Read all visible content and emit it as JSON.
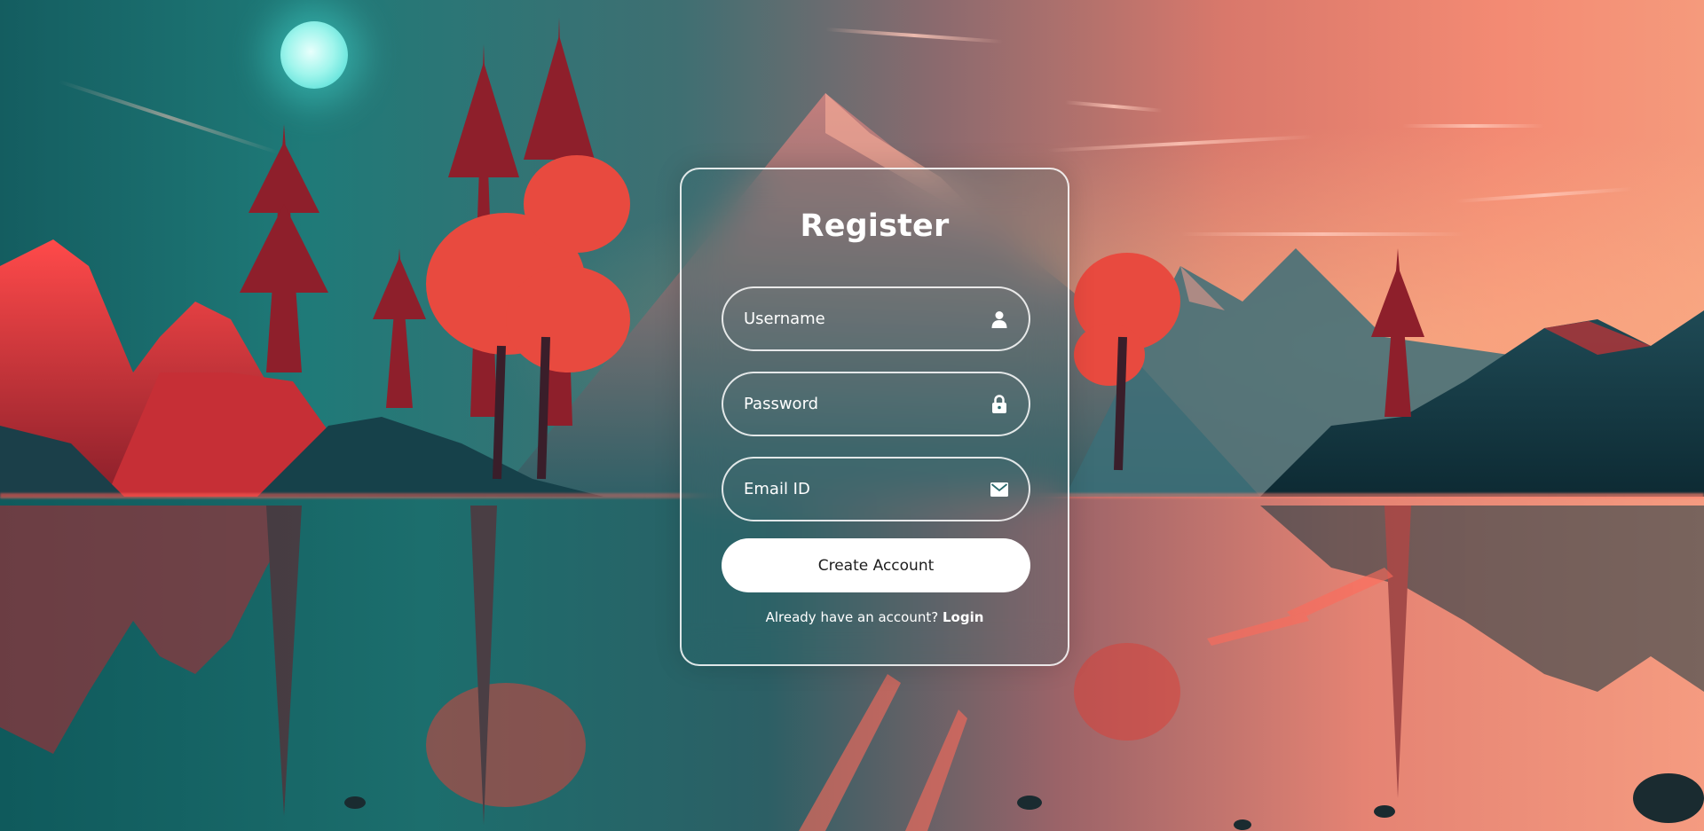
{
  "form": {
    "title": "Register",
    "username": {
      "placeholder": "Username",
      "value": "",
      "icon": "user-icon"
    },
    "password": {
      "placeholder": "Password",
      "value": "",
      "icon": "lock-icon"
    },
    "email": {
      "placeholder": "Email ID",
      "value": "",
      "icon": "envelope-icon"
    },
    "submit_label": "Create Account",
    "login_prompt": "Already have an account?",
    "login_link": "Login"
  },
  "colors": {
    "card_border": "#ffffff",
    "button_bg": "#ffffff",
    "button_text": "#1d1d1d",
    "text": "#ffffff"
  }
}
